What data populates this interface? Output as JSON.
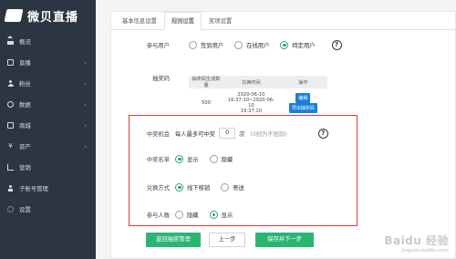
{
  "brand": {
    "name": "微贝直播"
  },
  "sidebar": {
    "items": [
      {
        "label": "概况",
        "icon": "home-icon",
        "chevron": false
      },
      {
        "label": "直播",
        "icon": "tv-icon",
        "chevron": true
      },
      {
        "label": "粉丝",
        "icon": "user-icon",
        "chevron": true
      },
      {
        "label": "数据",
        "icon": "eye-icon",
        "chevron": true
      },
      {
        "label": "商城",
        "icon": "bag-icon",
        "chevron": true
      },
      {
        "label": "资产",
        "icon": "yen-icon",
        "chevron": true
      },
      {
        "label": "营销",
        "icon": "bar-chart-icon",
        "chevron": false
      },
      {
        "label": "子账号管理",
        "icon": "person-icon",
        "chevron": false
      },
      {
        "label": "设置",
        "icon": "gear-icon",
        "chevron": false
      }
    ],
    "chevron_glyph": "‹"
  },
  "tabs": [
    {
      "label": "基本信息设置",
      "active": false
    },
    {
      "label": "规则设置",
      "active": true
    },
    {
      "label": "奖项设置",
      "active": false
    }
  ],
  "participants": {
    "label": "参与用户",
    "options": [
      {
        "label": "签到用户",
        "selected": false
      },
      {
        "label": "在线用户",
        "selected": false
      },
      {
        "label": "特定用户",
        "selected": true
      }
    ]
  },
  "lottery_code": {
    "label": "抽奖码",
    "columns": [
      "抽奖码生成数量",
      "兑换时间",
      "操作"
    ],
    "rows": [
      {
        "count": "500",
        "time_line1": "2020-06-10",
        "time_line2": "16:37:10~2020-06-10",
        "time_line3": "19:37:10",
        "actions": [
          "编辑",
          "导出抽奖码"
        ]
      }
    ]
  },
  "win_chance": {
    "label": "中奖机会",
    "prefix": "每人最多可中奖",
    "value": "0",
    "unit": "次",
    "hint": "(0则为不限制)"
  },
  "winner_list": {
    "label": "中奖名单",
    "options": [
      {
        "label": "显示",
        "selected": true
      },
      {
        "label": "隐藏",
        "selected": false
      }
    ]
  },
  "redeem_method": {
    "label": "兑换方式",
    "options": [
      {
        "label": "线下核销",
        "selected": true
      },
      {
        "label": "寄送",
        "selected": false
      }
    ]
  },
  "participant_count": {
    "label": "参与人数",
    "options": [
      {
        "label": "隐藏",
        "selected": false
      },
      {
        "label": "显示",
        "selected": true
      }
    ]
  },
  "buttons": {
    "back": "返回抽奖管理",
    "prev": "上一步",
    "save_next": "保存并下一步"
  },
  "help_glyph": "?",
  "watermark": {
    "brand": "Baidu 经验",
    "url": "jingyan.baidu.com"
  },
  "colors": {
    "sidebar_bg": "#2c3542",
    "accent_green": "#2bb573",
    "action_blue": "#1c7fd9",
    "highlight_red": "#e53935"
  }
}
